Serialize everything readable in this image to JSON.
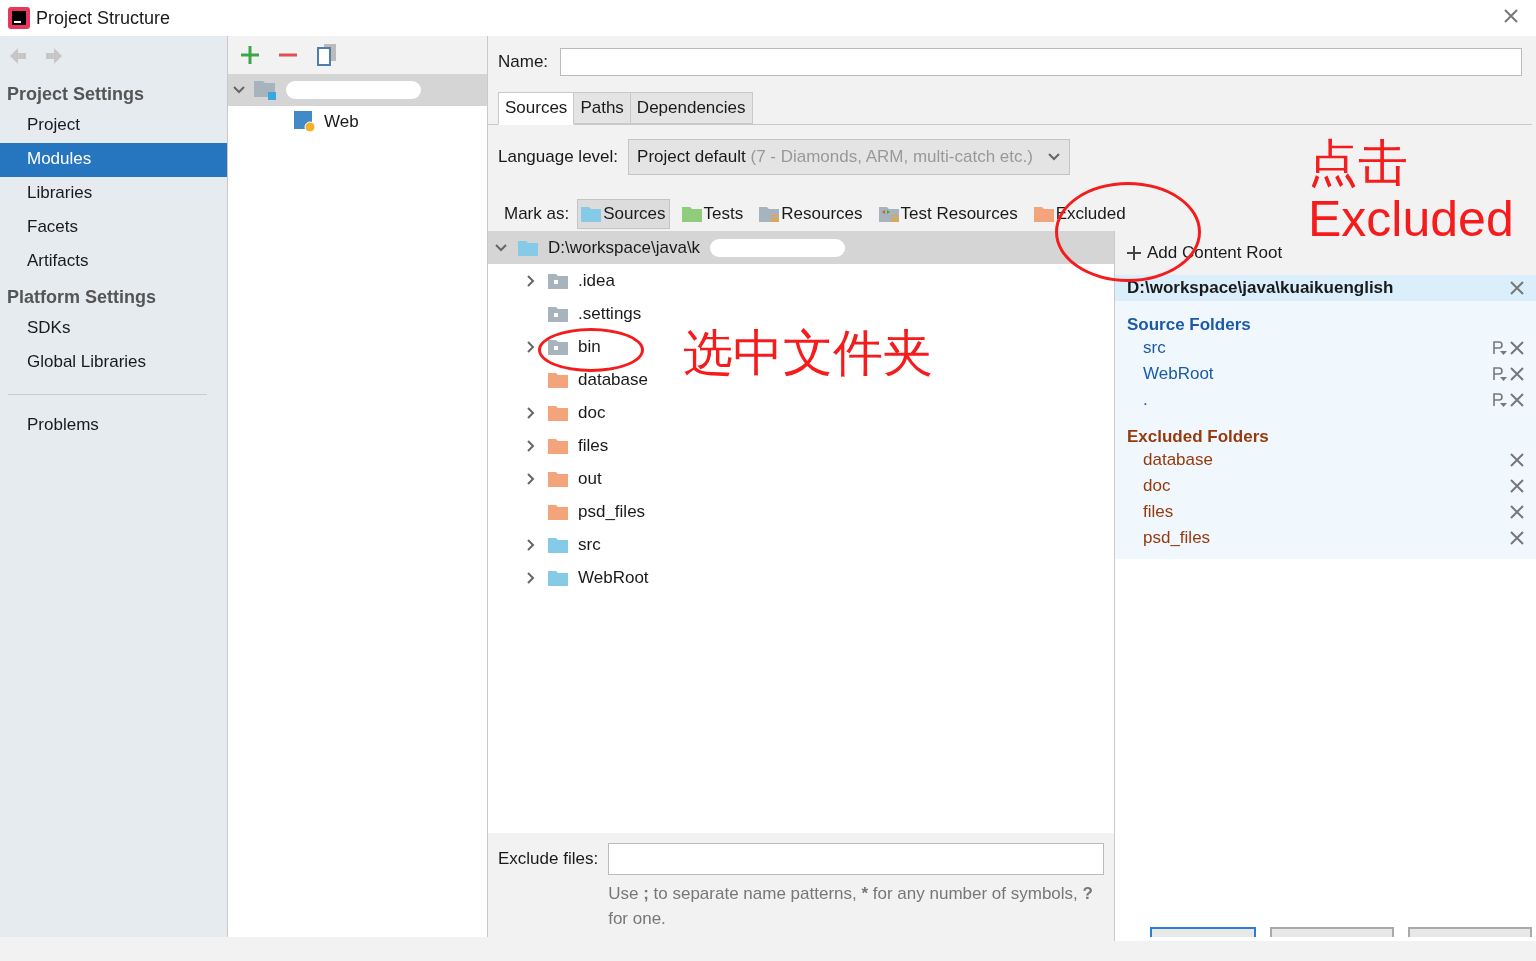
{
  "window": {
    "title": "Project Structure"
  },
  "sidebar": {
    "groups": [
      {
        "heading": "Project Settings",
        "items": [
          {
            "label": "Project",
            "selected": false
          },
          {
            "label": "Modules",
            "selected": true
          },
          {
            "label": "Libraries",
            "selected": false
          },
          {
            "label": "Facets",
            "selected": false
          },
          {
            "label": "Artifacts",
            "selected": false
          }
        ]
      },
      {
        "heading": "Platform Settings",
        "items": [
          {
            "label": "SDKs",
            "selected": false
          },
          {
            "label": "Global Libraries",
            "selected": false
          }
        ]
      }
    ],
    "bottom_items": [
      {
        "label": "Problems",
        "selected": false
      }
    ]
  },
  "modules": {
    "tree": [
      {
        "kind": "module",
        "selected": true,
        "expanded": true,
        "children": [
          {
            "kind": "web",
            "label": "Web",
            "selected": false
          }
        ]
      }
    ]
  },
  "name_field": {
    "label": "Name:"
  },
  "tabs": [
    {
      "label": "Sources",
      "selected": true
    },
    {
      "label": "Paths",
      "selected": false
    },
    {
      "label": "Dependencies",
      "selected": false
    }
  ],
  "language_level": {
    "label": "Language level:",
    "value": "Project default",
    "detail": "(7 - Diamonds, ARM, multi-catch etc.)"
  },
  "mark_as": {
    "label": "Mark as:",
    "buttons": [
      {
        "kind": "sources",
        "label": "Sources",
        "selected": true
      },
      {
        "kind": "tests",
        "label": "Tests",
        "selected": false
      },
      {
        "kind": "resources",
        "label": "Resources",
        "selected": false
      },
      {
        "kind": "test_resources",
        "label": "Test Resources",
        "selected": false
      },
      {
        "kind": "excluded",
        "label": "Excluded",
        "selected": false
      }
    ]
  },
  "folder_tree": {
    "root": {
      "label": "D:\\workspace\\java\\k",
      "kind": "source_root",
      "expanded": true
    },
    "children": [
      {
        "label": ".idea",
        "kind": "plain",
        "expandable": true
      },
      {
        "label": ".settings",
        "kind": "plain",
        "expandable": false
      },
      {
        "label": "bin",
        "kind": "plain",
        "expandable": true
      },
      {
        "label": "database",
        "kind": "excluded",
        "expandable": false
      },
      {
        "label": "doc",
        "kind": "excluded",
        "expandable": true
      },
      {
        "label": "files",
        "kind": "excluded",
        "expandable": true
      },
      {
        "label": "out",
        "kind": "excluded",
        "expandable": true
      },
      {
        "label": "psd_files",
        "kind": "excluded",
        "expandable": false
      },
      {
        "label": "src",
        "kind": "sources",
        "expandable": true
      },
      {
        "label": "WebRoot",
        "kind": "sources",
        "expandable": true
      }
    ]
  },
  "content_roots": {
    "add_label": "Add Content Root",
    "path": "D:\\workspace\\java\\kuaikuenglish",
    "sections": [
      {
        "kind": "sources",
        "title": "Source Folders",
        "items": [
          "src",
          "WebRoot",
          "."
        ]
      },
      {
        "kind": "excluded",
        "title": "Excluded Folders",
        "items": [
          "database",
          "doc",
          "files",
          "psd_files"
        ]
      }
    ]
  },
  "exclude_files": {
    "label": "Exclude files:",
    "hint_parts": [
      {
        "text": "Use ",
        "bold": false
      },
      {
        "text": ";",
        "bold": true
      },
      {
        "text": " to separate name patterns, ",
        "bold": false
      },
      {
        "text": "*",
        "bold": true
      },
      {
        "text": " for any number of symbols, ",
        "bold": false
      },
      {
        "text": "?",
        "bold": true
      },
      {
        "text": " for one.",
        "bold": false
      }
    ]
  },
  "annotations": [
    {
      "lines": [
        "点击",
        "Excluded"
      ]
    },
    {
      "lines": [
        "选中文件夹"
      ]
    }
  ]
}
